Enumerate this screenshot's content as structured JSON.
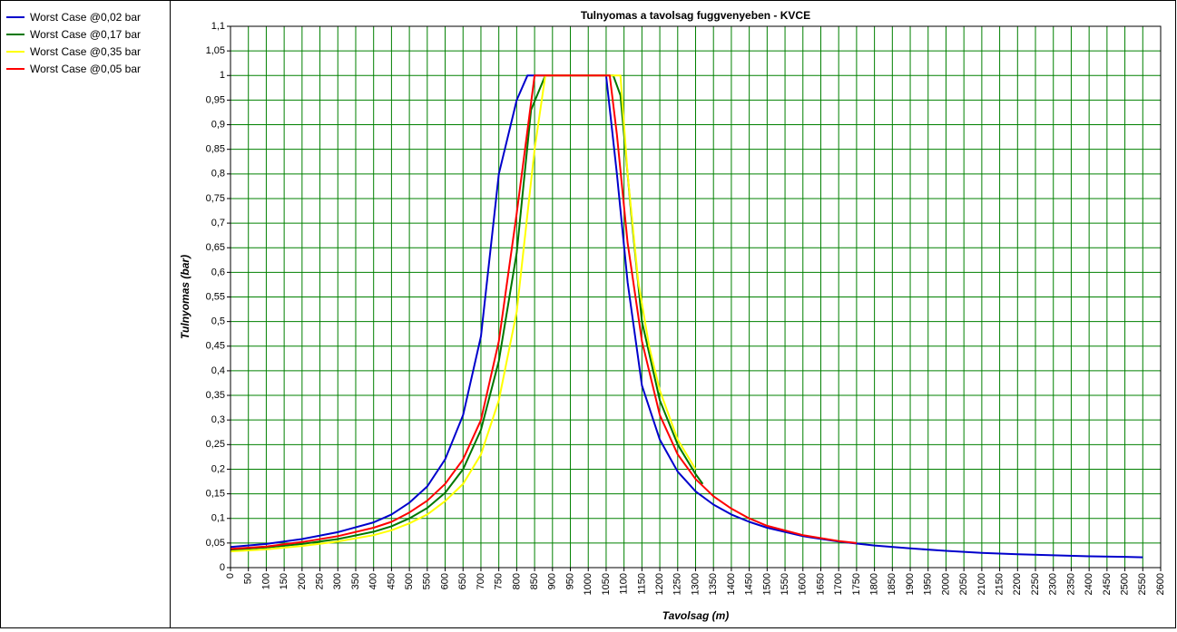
{
  "chart_data": {
    "type": "line",
    "title": "Tulnyomas a tavolsag fuggvenyeben - KVCE",
    "xlabel": "Tavolsag (m)",
    "ylabel": "Tulnyomas (bar)",
    "xlim": [
      0,
      2600
    ],
    "ylim": [
      0,
      1.1
    ],
    "x_ticks": [
      "0",
      "50",
      "100",
      "150",
      "200",
      "250",
      "300",
      "350",
      "400",
      "450",
      "500",
      "550",
      "600",
      "650",
      "700",
      "750",
      "800",
      "850",
      "900",
      "950",
      "1000",
      "1050",
      "1100",
      "1150",
      "1200",
      "1250",
      "1300",
      "1350",
      "1400",
      "1450",
      "1500",
      "1550",
      "1600",
      "1650",
      "1700",
      "1750",
      "1800",
      "1850",
      "1900",
      "1950",
      "2000",
      "2050",
      "2100",
      "2150",
      "2200",
      "2250",
      "2300",
      "2350",
      "2400",
      "2450",
      "2500",
      "2550",
      "2600"
    ],
    "y_ticks": [
      "0",
      "0,05",
      "0,1",
      "0,15",
      "0,2",
      "0,25",
      "0,3",
      "0,35",
      "0,4",
      "0,45",
      "0,5",
      "0,55",
      "0,6",
      "0,65",
      "0,7",
      "0,75",
      "0,8",
      "0,85",
      "0,9",
      "0,95",
      "1",
      "1,05",
      "1,1"
    ],
    "grid": true,
    "legend": "left panel",
    "series": [
      {
        "name": "Worst Case @0,02 bar",
        "color": "#0000cc",
        "points": [
          [
            0,
            0.042
          ],
          [
            100,
            0.048
          ],
          [
            200,
            0.058
          ],
          [
            300,
            0.072
          ],
          [
            400,
            0.092
          ],
          [
            450,
            0.108
          ],
          [
            500,
            0.132
          ],
          [
            550,
            0.165
          ],
          [
            600,
            0.22
          ],
          [
            650,
            0.31
          ],
          [
            700,
            0.47
          ],
          [
            750,
            0.8
          ],
          [
            800,
            0.95
          ],
          [
            830,
            1.0
          ],
          [
            1050,
            1.0
          ],
          [
            1080,
            0.8
          ],
          [
            1110,
            0.58
          ],
          [
            1150,
            0.37
          ],
          [
            1200,
            0.26
          ],
          [
            1250,
            0.195
          ],
          [
            1300,
            0.155
          ],
          [
            1350,
            0.128
          ],
          [
            1400,
            0.108
          ],
          [
            1450,
            0.093
          ],
          [
            1500,
            0.081
          ],
          [
            1600,
            0.064
          ],
          [
            1700,
            0.053
          ],
          [
            1800,
            0.045
          ],
          [
            1900,
            0.039
          ],
          [
            2000,
            0.034
          ],
          [
            2100,
            0.03
          ],
          [
            2200,
            0.027
          ],
          [
            2300,
            0.025
          ],
          [
            2400,
            0.023
          ],
          [
            2500,
            0.022
          ],
          [
            2550,
            0.021
          ]
        ]
      },
      {
        "name": "Worst Case @0,17 bar",
        "color": "#007700",
        "points": [
          [
            0,
            0.036
          ],
          [
            100,
            0.041
          ],
          [
            200,
            0.048
          ],
          [
            300,
            0.058
          ],
          [
            400,
            0.073
          ],
          [
            450,
            0.084
          ],
          [
            500,
            0.1
          ],
          [
            550,
            0.121
          ],
          [
            600,
            0.152
          ],
          [
            650,
            0.2
          ],
          [
            700,
            0.28
          ],
          [
            750,
            0.42
          ],
          [
            800,
            0.64
          ],
          [
            840,
            0.93
          ],
          [
            880,
            1.0
          ],
          [
            1070,
            1.0
          ],
          [
            1090,
            0.96
          ],
          [
            1120,
            0.72
          ],
          [
            1150,
            0.5
          ],
          [
            1200,
            0.34
          ],
          [
            1250,
            0.25
          ],
          [
            1300,
            0.19
          ],
          [
            1320,
            0.17
          ]
        ]
      },
      {
        "name": "Worst Case @0,35 bar",
        "color": "#ffff00",
        "points": [
          [
            0,
            0.033
          ],
          [
            100,
            0.037
          ],
          [
            200,
            0.044
          ],
          [
            300,
            0.053
          ],
          [
            400,
            0.066
          ],
          [
            450,
            0.076
          ],
          [
            500,
            0.09
          ],
          [
            550,
            0.108
          ],
          [
            600,
            0.135
          ],
          [
            650,
            0.17
          ],
          [
            700,
            0.23
          ],
          [
            750,
            0.34
          ],
          [
            800,
            0.52
          ],
          [
            850,
            0.85
          ],
          [
            880,
            1.0
          ],
          [
            1090,
            1.0
          ],
          [
            1110,
            0.8
          ],
          [
            1140,
            0.58
          ],
          [
            1170,
            0.45
          ],
          [
            1200,
            0.36
          ],
          [
            1250,
            0.26
          ],
          [
            1300,
            0.2
          ]
        ]
      },
      {
        "name": "Worst Case @0,05 bar",
        "color": "#ff0000",
        "points": [
          [
            0,
            0.038
          ],
          [
            100,
            0.043
          ],
          [
            200,
            0.052
          ],
          [
            300,
            0.064
          ],
          [
            400,
            0.081
          ],
          [
            450,
            0.093
          ],
          [
            500,
            0.112
          ],
          [
            550,
            0.136
          ],
          [
            600,
            0.17
          ],
          [
            650,
            0.22
          ],
          [
            700,
            0.3
          ],
          [
            750,
            0.46
          ],
          [
            800,
            0.72
          ],
          [
            850,
            1.0
          ],
          [
            1060,
            1.0
          ],
          [
            1080,
            0.88
          ],
          [
            1110,
            0.66
          ],
          [
            1150,
            0.46
          ],
          [
            1200,
            0.31
          ],
          [
            1250,
            0.23
          ],
          [
            1300,
            0.18
          ],
          [
            1350,
            0.145
          ],
          [
            1400,
            0.12
          ],
          [
            1450,
            0.1
          ],
          [
            1500,
            0.085
          ],
          [
            1600,
            0.066
          ],
          [
            1700,
            0.054
          ],
          [
            1750,
            0.05
          ]
        ]
      }
    ]
  }
}
